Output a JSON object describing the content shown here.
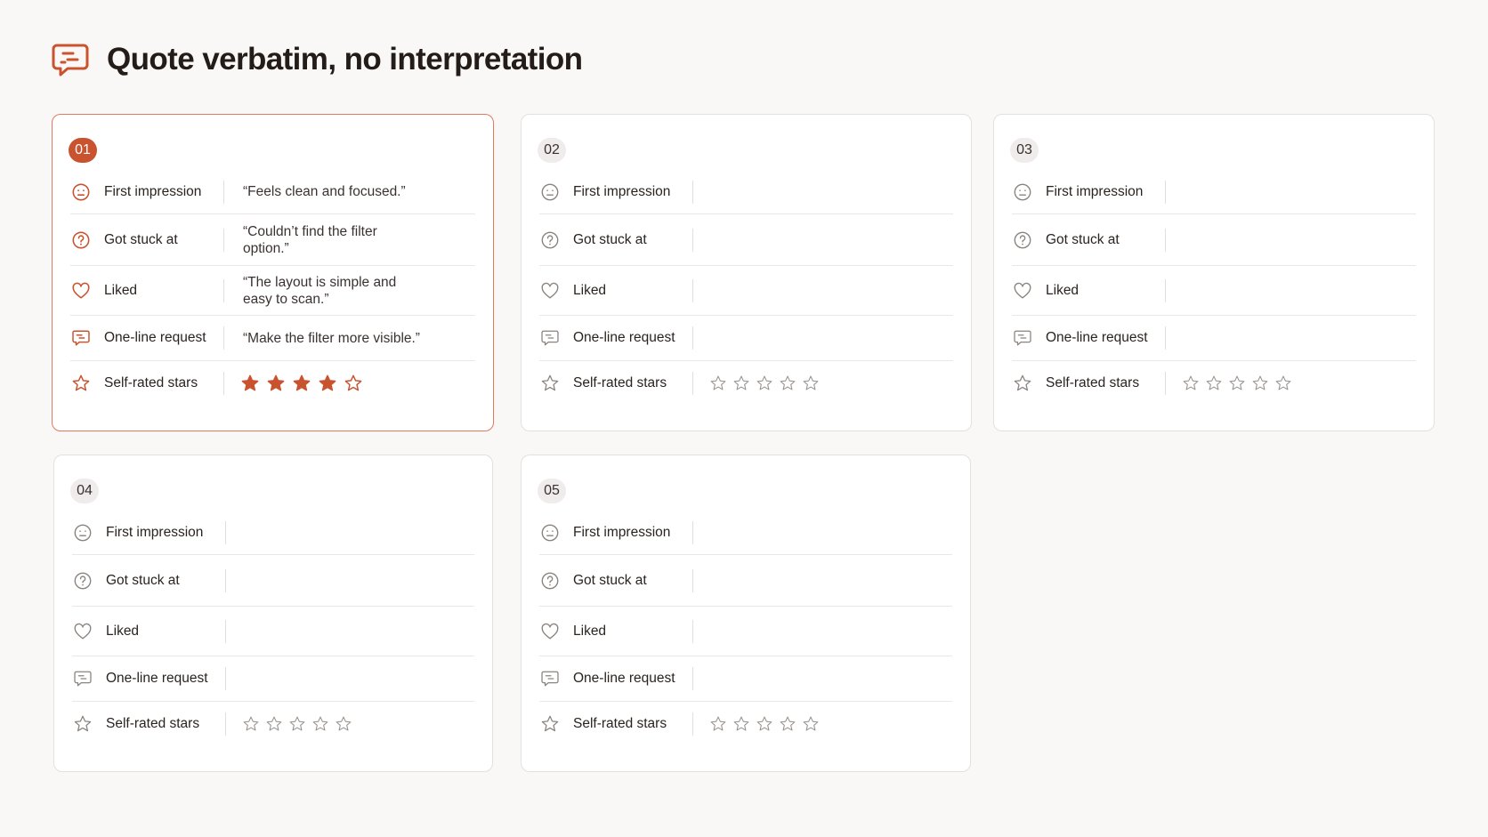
{
  "page": {
    "title": "Quote verbatim, no interpretation",
    "icon": "message-icon"
  },
  "theme": {
    "accent": "#c9532f",
    "accent_border": "#e07a5f",
    "muted_icon": "#8a837e",
    "star_empty": "#9a938e"
  },
  "labels": {
    "first_impression": "First impression",
    "got_stuck": "Got stuck at",
    "liked": "Liked",
    "request": "One-line request",
    "stars": "Self-rated stars"
  },
  "cards": [
    {
      "number": "01",
      "active": true,
      "first_impression": "“Feels clean and focused.”",
      "got_stuck": "“Couldn’t find the filter option.”",
      "liked": "“The layout is simple and easy to scan.”",
      "request": "“Make the filter more visible.”",
      "stars_rating": 4,
      "stars_max": 5
    },
    {
      "number": "02",
      "active": false,
      "first_impression": "",
      "got_stuck": "",
      "liked": "",
      "request": "",
      "stars_rating": 0,
      "stars_max": 5
    },
    {
      "number": "03",
      "active": false,
      "first_impression": "",
      "got_stuck": "",
      "liked": "",
      "request": "",
      "stars_rating": 0,
      "stars_max": 5
    },
    {
      "number": "04",
      "active": false,
      "first_impression": "",
      "got_stuck": "",
      "liked": "",
      "request": "",
      "stars_rating": 0,
      "stars_max": 5
    },
    {
      "number": "05",
      "active": false,
      "first_impression": "",
      "got_stuck": "",
      "liked": "",
      "request": "",
      "stars_rating": 0,
      "stars_max": 5
    }
  ]
}
